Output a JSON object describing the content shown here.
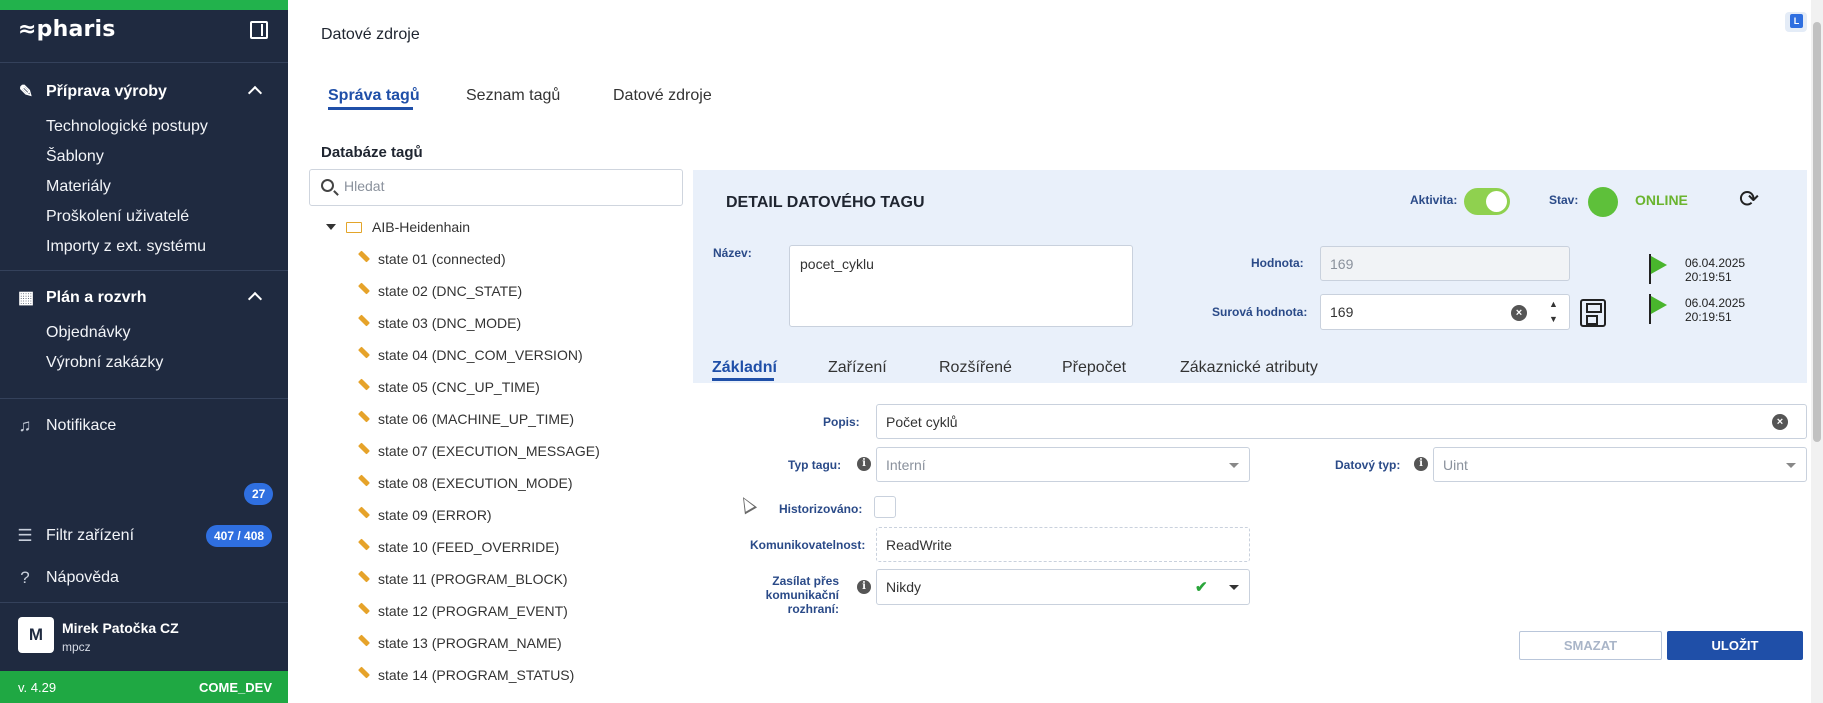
{
  "sidebar": {
    "logo": "≈pharis",
    "section1": {
      "title": "Příprava výroby",
      "items": [
        "Technologické postupy",
        "Šablony",
        "Materiály",
        "Proškolení uživatelé",
        "Importy z ext. systému"
      ]
    },
    "section2": {
      "title": "Plán a rozvrh",
      "items": [
        "Objednávky",
        "Výrobní zakázky"
      ]
    },
    "notifications": {
      "label": "Notifikace",
      "count": "27"
    },
    "device_filter": {
      "label": "Filtr zařízení",
      "count": "407 / 408"
    },
    "help": {
      "label": "Nápověda"
    },
    "user": {
      "initial": "M",
      "name": "Mirek Patočka CZ",
      "login": "mpcz"
    },
    "footer": {
      "version": "v. 4.29",
      "env": "COME_DEV"
    }
  },
  "main": {
    "page_title": "Datové zdroje",
    "tabs": [
      "Správa tagů",
      "Seznam tagů",
      "Datové zdroje"
    ],
    "db_title": "Databáze tagů",
    "search_placeholder": "Hledat",
    "tree": {
      "root": "AIB-Heidenhain",
      "items": [
        "state 01 (connected)",
        "state 02 (DNC_STATE)",
        "state 03 (DNC_MODE)",
        "state 04 (DNC_COM_VERSION)",
        "state 05 (CNC_UP_TIME)",
        "state 06 (MACHINE_UP_TIME)",
        "state 07 (EXECUTION_MESSAGE)",
        "state 08 (EXECUTION_MODE)",
        "state 09 (ERROR)",
        "state 10 (FEED_OVERRIDE)",
        "state 11 (PROGRAM_BLOCK)",
        "state 12 (PROGRAM_EVENT)",
        "state 13 (PROGRAM_NAME)",
        "state 14 (PROGRAM_STATUS)"
      ]
    }
  },
  "detail": {
    "title": "DETAIL DATOVÉHO TAGU",
    "activity_label": "Aktivita:",
    "activity_on": true,
    "status_label": "Stav:",
    "status_value": "ONLINE",
    "name_label": "Název:",
    "name_value": "pocet_cyklu",
    "value_label": "Hodnota:",
    "value_value": "169",
    "raw_label": "Surová hodnota:",
    "raw_value": "169",
    "ts1_date": "06.04.2025",
    "ts1_time": "20:19:51",
    "ts2_date": "06.04.2025",
    "ts2_time": "20:19:51",
    "tabs": [
      "Základní",
      "Zařízení",
      "Rozšířené",
      "Přepočet",
      "Zákaznické atributy"
    ],
    "form": {
      "popis_label": "Popis:",
      "popis_value": "Počet cyklů",
      "typ_label": "Typ tagu:",
      "typ_value": "Interní",
      "datovy_label": "Datový typ:",
      "datovy_value": "Uint",
      "hist_label": "Historizováno:",
      "komun_label": "Komunikovatelnost:",
      "komun_value": "ReadWrite",
      "zasilat_label_1": "Zasílat přes komunikační",
      "zasilat_label_2": "rozhraní:",
      "zasilat_value": "Nikdy"
    },
    "buttons": {
      "delete": "SMAZAT",
      "save": "ULOŽIT"
    }
  },
  "corner_badge": "L",
  "colors": {
    "sidebar": "#1f2a40",
    "accent": "#1f4fa8",
    "online": "#5ec03a",
    "footer": "#1fa843"
  }
}
